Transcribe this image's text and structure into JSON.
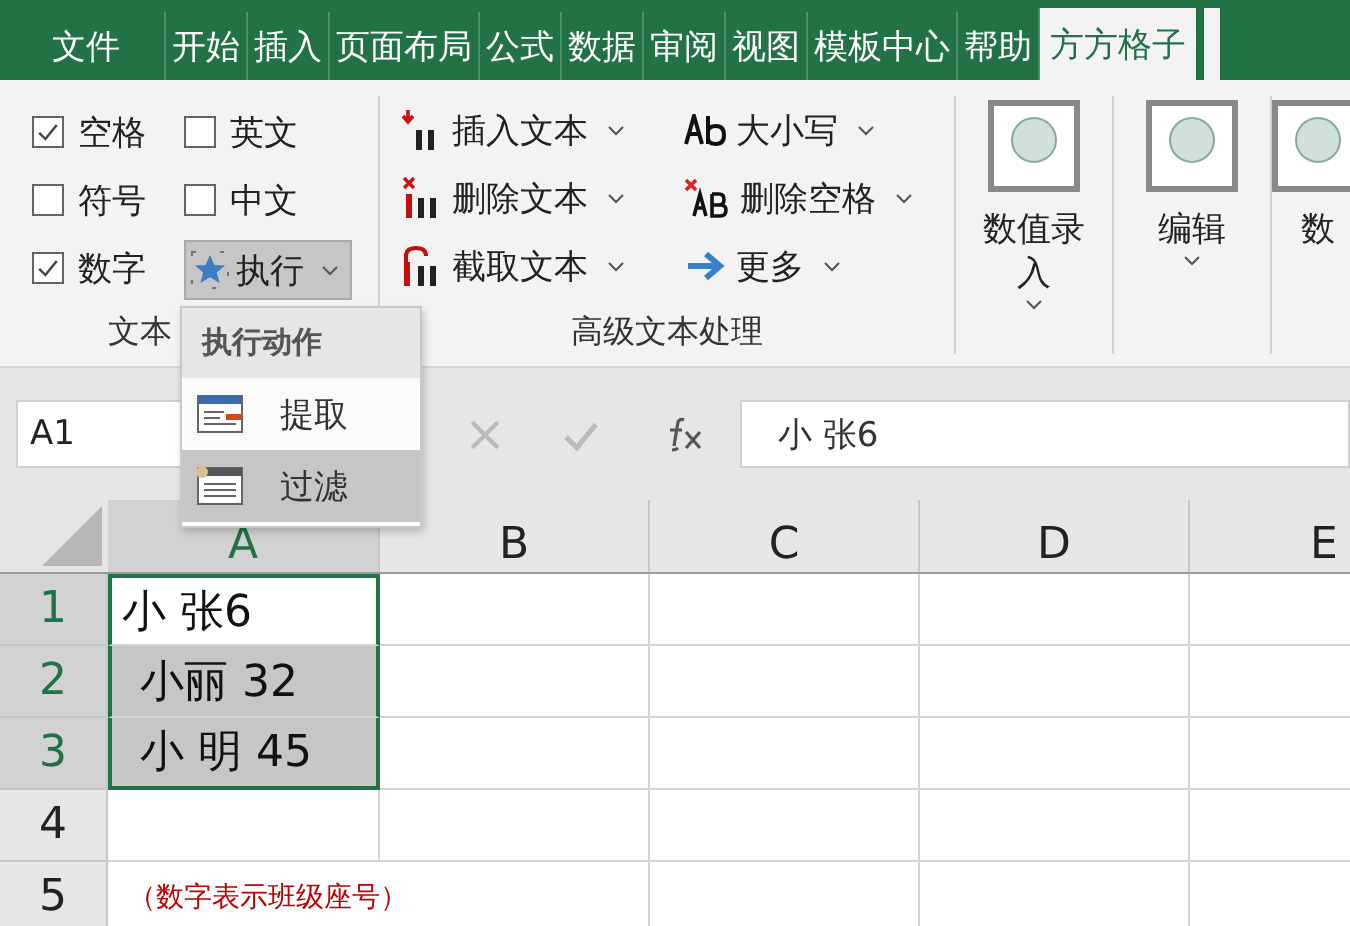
{
  "tabs": [
    {
      "label": "文件",
      "selected": false
    },
    {
      "label": "开始",
      "selected": false
    },
    {
      "label": "插入",
      "selected": false
    },
    {
      "label": "页面布局",
      "selected": false
    },
    {
      "label": "公式",
      "selected": false
    },
    {
      "label": "数据",
      "selected": false
    },
    {
      "label": "审阅",
      "selected": false
    },
    {
      "label": "视图",
      "selected": false
    },
    {
      "label": "模板中心",
      "selected": false
    },
    {
      "label": "帮助",
      "selected": false
    },
    {
      "label": "方方格子",
      "selected": true
    }
  ],
  "ribbon": {
    "text_group": {
      "label": "文本",
      "options": [
        {
          "label": "空格",
          "checked": true
        },
        {
          "label": "英文",
          "checked": false
        },
        {
          "label": "符号",
          "checked": false
        },
        {
          "label": "中文",
          "checked": false
        },
        {
          "label": "数字",
          "checked": true
        }
      ],
      "execute": {
        "label": "执行",
        "expanded": true
      }
    },
    "advanced_group": {
      "label": "高级文本处理",
      "commands": [
        {
          "label": "插入文本",
          "kind": "insert"
        },
        {
          "label": "删除文本",
          "kind": "delete"
        },
        {
          "label": "截取文本",
          "kind": "cut"
        },
        {
          "label": "大小写",
          "kind": "case"
        },
        {
          "label": "删除空格",
          "kind": "trim"
        },
        {
          "label": "更多",
          "kind": "more"
        }
      ]
    },
    "big_buttons": [
      {
        "label": "数值录入"
      },
      {
        "label": "编辑"
      },
      {
        "label": "数"
      }
    ]
  },
  "formula_bar": {
    "name_box": "A1",
    "formula": "小 张6"
  },
  "grid": {
    "columns": [
      {
        "label": "A",
        "selected": true
      },
      {
        "label": "B",
        "selected": false
      },
      {
        "label": "C",
        "selected": false
      },
      {
        "label": "D",
        "selected": false
      },
      {
        "label": "E",
        "selected": false
      }
    ],
    "rows": [
      {
        "header": "1",
        "selected": true,
        "a": {
          "text": "小 张6",
          "kind": "active"
        }
      },
      {
        "header": "2",
        "selected": true,
        "a": {
          "text": "小丽 32",
          "kind": "selected"
        }
      },
      {
        "header": "3",
        "selected": true,
        "a": {
          "text": "小 明 45",
          "kind": "selected"
        }
      },
      {
        "header": "4",
        "selected": false
      },
      {
        "header": "5",
        "selected": false,
        "a": {
          "text": "（数字表示班级座号）",
          "kind": "note"
        }
      }
    ]
  },
  "menu": {
    "title": "执行动作",
    "items": [
      {
        "label": "提取",
        "selected": false
      },
      {
        "label": "过滤",
        "selected": true
      }
    ]
  }
}
